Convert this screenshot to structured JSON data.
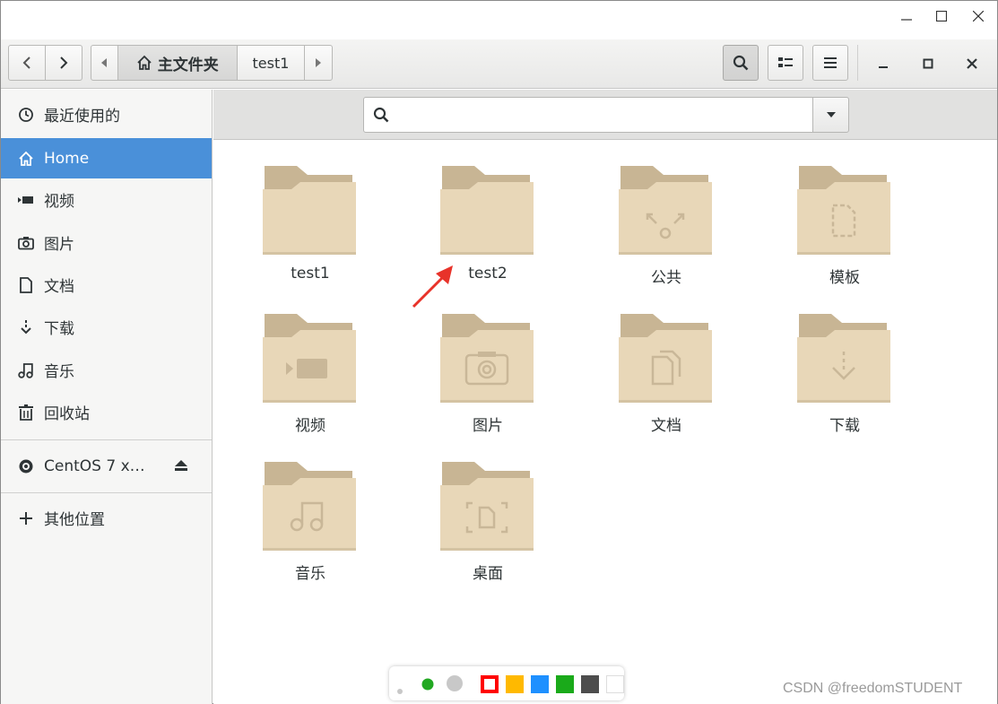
{
  "window": {
    "controls": [
      "minimize-icon",
      "maximize-icon",
      "close-icon"
    ]
  },
  "headerbar": {
    "breadcrumb_home": "主文件夹",
    "breadcrumb_current": "test1",
    "icons": [
      "back-icon",
      "forward-icon",
      "path-left-icon",
      "home-icon",
      "path-right-icon",
      "search-icon",
      "view-icon",
      "menu-icon",
      "minimize-icon",
      "maximize-icon",
      "close-icon"
    ]
  },
  "sidebar": {
    "items": [
      {
        "label": "最近使用的",
        "icon": "recent-icon"
      },
      {
        "label": "Home",
        "icon": "home-icon",
        "selected": true
      },
      {
        "label": "视频",
        "icon": "video-icon"
      },
      {
        "label": "图片",
        "icon": "camera-icon"
      },
      {
        "label": "文档",
        "icon": "document-icon"
      },
      {
        "label": "下载",
        "icon": "download-icon"
      },
      {
        "label": "音乐",
        "icon": "music-icon"
      },
      {
        "label": "回收站",
        "icon": "trash-icon"
      }
    ],
    "devices": [
      {
        "label": "CentOS 7 x…",
        "icon": "disc-icon",
        "action_icon": "eject-icon"
      }
    ],
    "other": {
      "label": "其他位置",
      "icon": "plus-icon"
    }
  },
  "search": {
    "value": "",
    "placeholder": "",
    "icon": "search-icon",
    "dropdown_icon": "chevron-down-icon"
  },
  "folders": [
    {
      "name": "test1",
      "emblem": "none"
    },
    {
      "name": "test2",
      "emblem": "none"
    },
    {
      "name": "公共",
      "emblem": "share"
    },
    {
      "name": "模板",
      "emblem": "template"
    },
    {
      "name": "视频",
      "emblem": "video"
    },
    {
      "name": "图片",
      "emblem": "camera"
    },
    {
      "name": "文档",
      "emblem": "document"
    },
    {
      "name": "下载",
      "emblem": "download"
    },
    {
      "name": "音乐",
      "emblem": "music"
    },
    {
      "name": "桌面",
      "emblem": "desktop"
    }
  ],
  "colors": {
    "accent": "#4a90d9",
    "folder_back": "#c8b594",
    "folder_front": "#e8d7b8",
    "emblem": "#c9b798",
    "arrow": "#e8332a"
  },
  "screenshot_toolbar": {
    "colors": [
      "#ff0000",
      "#ffb900",
      "#1e90ff",
      "#1aaa1a",
      "#4d4d4d",
      "#ffffff"
    ]
  },
  "watermark": "CSDN @freedomSTUDENT"
}
